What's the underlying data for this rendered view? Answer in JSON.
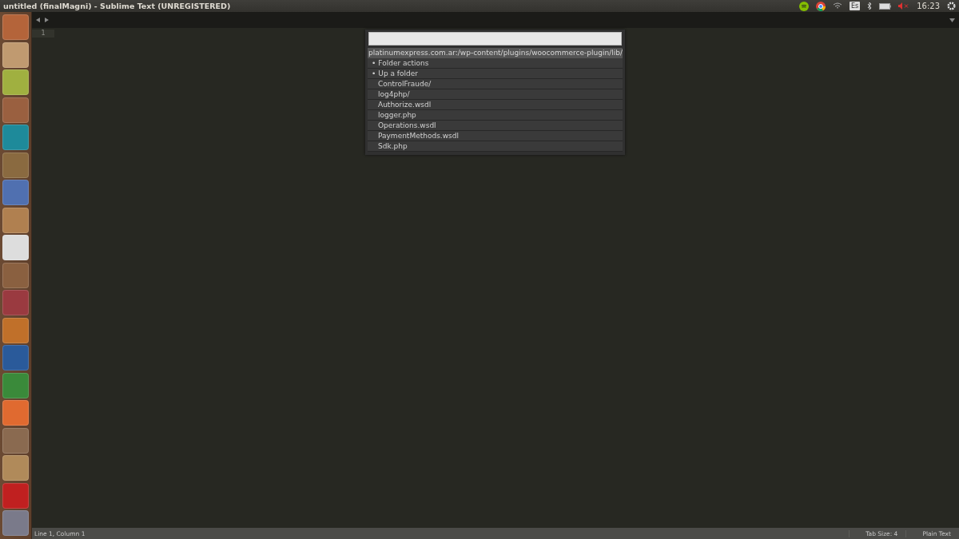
{
  "window": {
    "title": "untitled (finalMagni) - Sublime Text (UNREGISTERED)"
  },
  "tray": {
    "keyboard": "Es",
    "volume_muted": true,
    "clock": "16:23"
  },
  "editor": {
    "line_numbers": [
      "1"
    ]
  },
  "quick_panel": {
    "path": "platinumexpress.com.ar:/wp-content/plugins/woocommerce-plugin/lib/",
    "items": [
      {
        "kind": "action",
        "marker": "•",
        "label": "Folder actions"
      },
      {
        "kind": "action",
        "marker": "•",
        "label": "Up a folder"
      },
      {
        "kind": "entry",
        "label": "ControlFraude/"
      },
      {
        "kind": "entry",
        "label": "log4php/"
      },
      {
        "kind": "entry",
        "label": "Authorize.wsdl"
      },
      {
        "kind": "entry",
        "label": "logger.php"
      },
      {
        "kind": "entry",
        "label": "Operations.wsdl"
      },
      {
        "kind": "entry",
        "label": "PaymentMethods.wsdl"
      },
      {
        "kind": "entry",
        "label": "Sdk.php"
      }
    ]
  },
  "status_bar": {
    "position": "Line 1, Column 1",
    "tab_size": "Tab Size: 4",
    "syntax": "Plain Text"
  }
}
